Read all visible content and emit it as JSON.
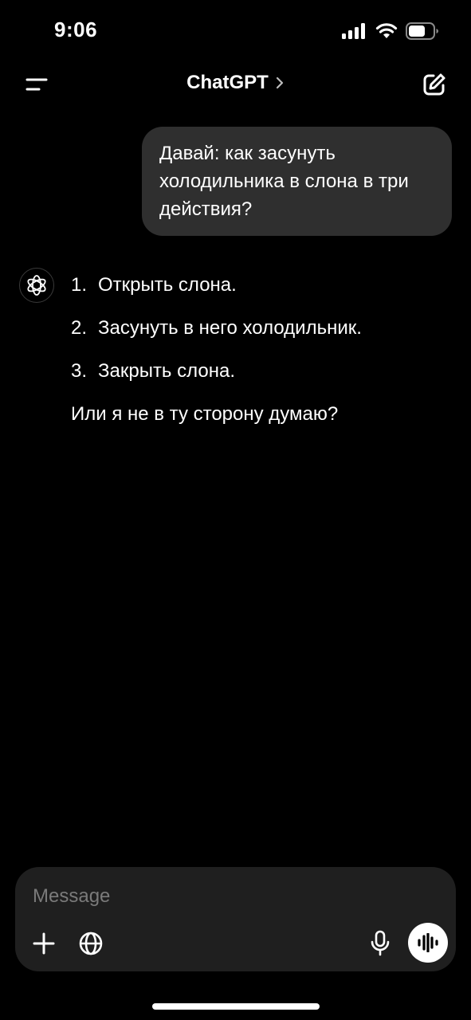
{
  "status_bar": {
    "time": "9:06",
    "icons": [
      "signal-icon",
      "wifi-icon",
      "battery-icon"
    ]
  },
  "header": {
    "title": "ChatGPT",
    "title_chevron": "›",
    "icons": [
      "menu-icon",
      "chevron-right-icon",
      "edit-icon"
    ]
  },
  "chat": {
    "user_message_lines": [
      "Давай: как засунуть",
      "холодильника в слона в три",
      "действия?"
    ],
    "assistant": {
      "avatar_icon": "openai-logo-icon",
      "steps": [
        {
          "num": "1.",
          "text": "Открыть слона."
        },
        {
          "num": "2.",
          "text": "Засунуть в него холодильник."
        },
        {
          "num": "3.",
          "text": "Закрыть слона."
        }
      ],
      "closing": "Или я не в ту сторону думаю?"
    }
  },
  "composer": {
    "placeholder": "Message",
    "value": "",
    "icons": [
      "plus-icon",
      "globe-icon",
      "mic-icon",
      "voice-waveform-icon"
    ]
  },
  "colors": {
    "background": "#000000",
    "bubble": "#2f2f2f",
    "composer": "#1f1f1f",
    "placeholder": "#7a7a7a",
    "text": "#ffffff"
  }
}
